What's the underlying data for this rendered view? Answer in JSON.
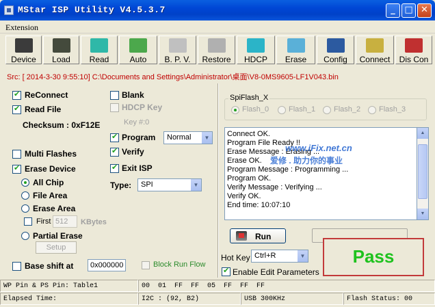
{
  "window": {
    "title": "MStar ISP Utility V4.5.3.7",
    "min": "_",
    "max": "□",
    "close": "✕"
  },
  "menu": {
    "extension": "Extension"
  },
  "toolbar": [
    {
      "label": "Device",
      "icon": "chip-icon",
      "color": "#3b3b3b"
    },
    {
      "label": "Load",
      "icon": "load-chip-icon",
      "color": "#444a3c"
    },
    {
      "label": "Read",
      "icon": "read-book-icon",
      "color": "#2fb8a8"
    },
    {
      "label": "Auto",
      "icon": "auto-map-icon",
      "color": "#4ca84c"
    },
    {
      "label": "B. P. V.",
      "icon": "bpv-check-icon",
      "color": "#c0c0c0"
    },
    {
      "label": "Restore",
      "icon": "restore-sticks-icon",
      "color": "#b0b0b0"
    },
    {
      "label": "HDCP",
      "icon": "hdcp-book-icon",
      "color": "#2bb4c8"
    },
    {
      "label": "Erase",
      "icon": "erase-icon",
      "color": "#5ab0d8"
    },
    {
      "label": "Config",
      "icon": "monitor-icon",
      "color": "#2c5aa0"
    },
    {
      "label": "Connect",
      "icon": "connect-chip-icon",
      "color": "#c8b040"
    },
    {
      "label": "Dis Con",
      "icon": "disconnect-icon",
      "color": "#c03030"
    }
  ],
  "source": {
    "path": "Src: [ 2014-3-30 9:55:10]  C:\\Documents and Settings\\Administrator\\桌面\\V8-0MS9605-LF1V043.bin"
  },
  "left": {
    "reconnect": "ReConnect",
    "read_file": "Read File",
    "checksum": "Checksum : 0xF12E",
    "blank": "Blank",
    "hdcp_key": "HDCP Key",
    "key_num": "Key #:0",
    "program": "Program",
    "program_mode": "Normal",
    "verify": "Verify",
    "exit_isp": "Exit ISP",
    "type_label": "Type:",
    "type_value": "SPI",
    "multi_flashes": "Multi Flashes",
    "erase_device": "Erase Device",
    "all_chip": "All Chip",
    "file_area": "File Area",
    "erase_area": "Erase Area",
    "first": "First",
    "first_value": "512",
    "kbytes": "KBytes",
    "partial_erase": "Partial Erase",
    "setup": "Setup",
    "base_shift": "Base shift at",
    "base_shift_value": "0x000000",
    "block_run_flow": "Block Run Flow"
  },
  "right": {
    "spiflash_title": "SpiFlash_X",
    "flash_options": [
      "Flash_0",
      "Flash_1",
      "Flash_2",
      "Flash_3"
    ],
    "log": [
      "Connect OK.",
      "Program File Ready !!",
      "Erase Message : Erasing ...",
      "Erase OK.",
      "Program Message : Programming ...",
      "Program OK.",
      "Verify Message : Verifying ...",
      "Verify OK.",
      "End time: 10:07:10"
    ],
    "watermark_en": "www.iFix.net.cn",
    "watermark_cn": "爱修 . 助力你的事业",
    "run": "Run",
    "hotkey_label": "Hot Key",
    "hotkey_value": "Ctrl+R",
    "enable_edit": "Enable Edit Parameters",
    "result": "Pass"
  },
  "status": {
    "wp_pin": "WP Pin & PS Pin: Table1",
    "bytes": [
      "00",
      "01",
      "FF",
      "FF",
      "05",
      "FF",
      "FF",
      "FF"
    ],
    "elapsed": "Elapsed Time:",
    "i2c": "I2C : (92, B2)",
    "usb": "USB  300KHz",
    "flash_status": "Flash Status: 00"
  }
}
